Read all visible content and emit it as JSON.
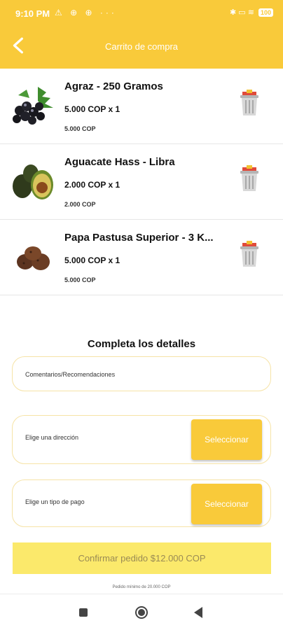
{
  "status_bar": {
    "time": "9:10 PM",
    "left_icons": [
      "warning-icon",
      "sync-icon",
      "sync-icon",
      "more-icon"
    ],
    "left_glyphs": "⚠ ⊕ ⊕ ···",
    "right_glyphs": "✱ ▭ ≋",
    "battery": "100"
  },
  "app_bar": {
    "title": "Carrito de compra"
  },
  "cart": {
    "items": [
      {
        "name": "Agraz - 250 Gramos",
        "price_qty": "5.000 COP  x 1",
        "subtotal": "5.000 COP"
      },
      {
        "name": "Aguacate Hass - Libra",
        "price_qty": "2.000 COP  x 1",
        "subtotal": "2.000 COP"
      },
      {
        "name": "Papa Pastusa Superior - 3 K...",
        "price_qty": "5.000 COP  x 1",
        "subtotal": "5.000 COP"
      }
    ]
  },
  "details": {
    "title": "Completa los detalles",
    "comments_label": "Comentarios/Recomendaciones",
    "address_label": "Elige una dirección",
    "address_button": "Seleccionar",
    "payment_label": "Elige un tipo de pago",
    "payment_button": "Seleccionar"
  },
  "confirm": {
    "label": "Confirmar pedido $12.000 COP",
    "minimum_note": "Pedido mínimo de 20.000 COP"
  },
  "colors": {
    "brand": "#f9ca3a",
    "confirm_bg": "#fbe96b"
  }
}
